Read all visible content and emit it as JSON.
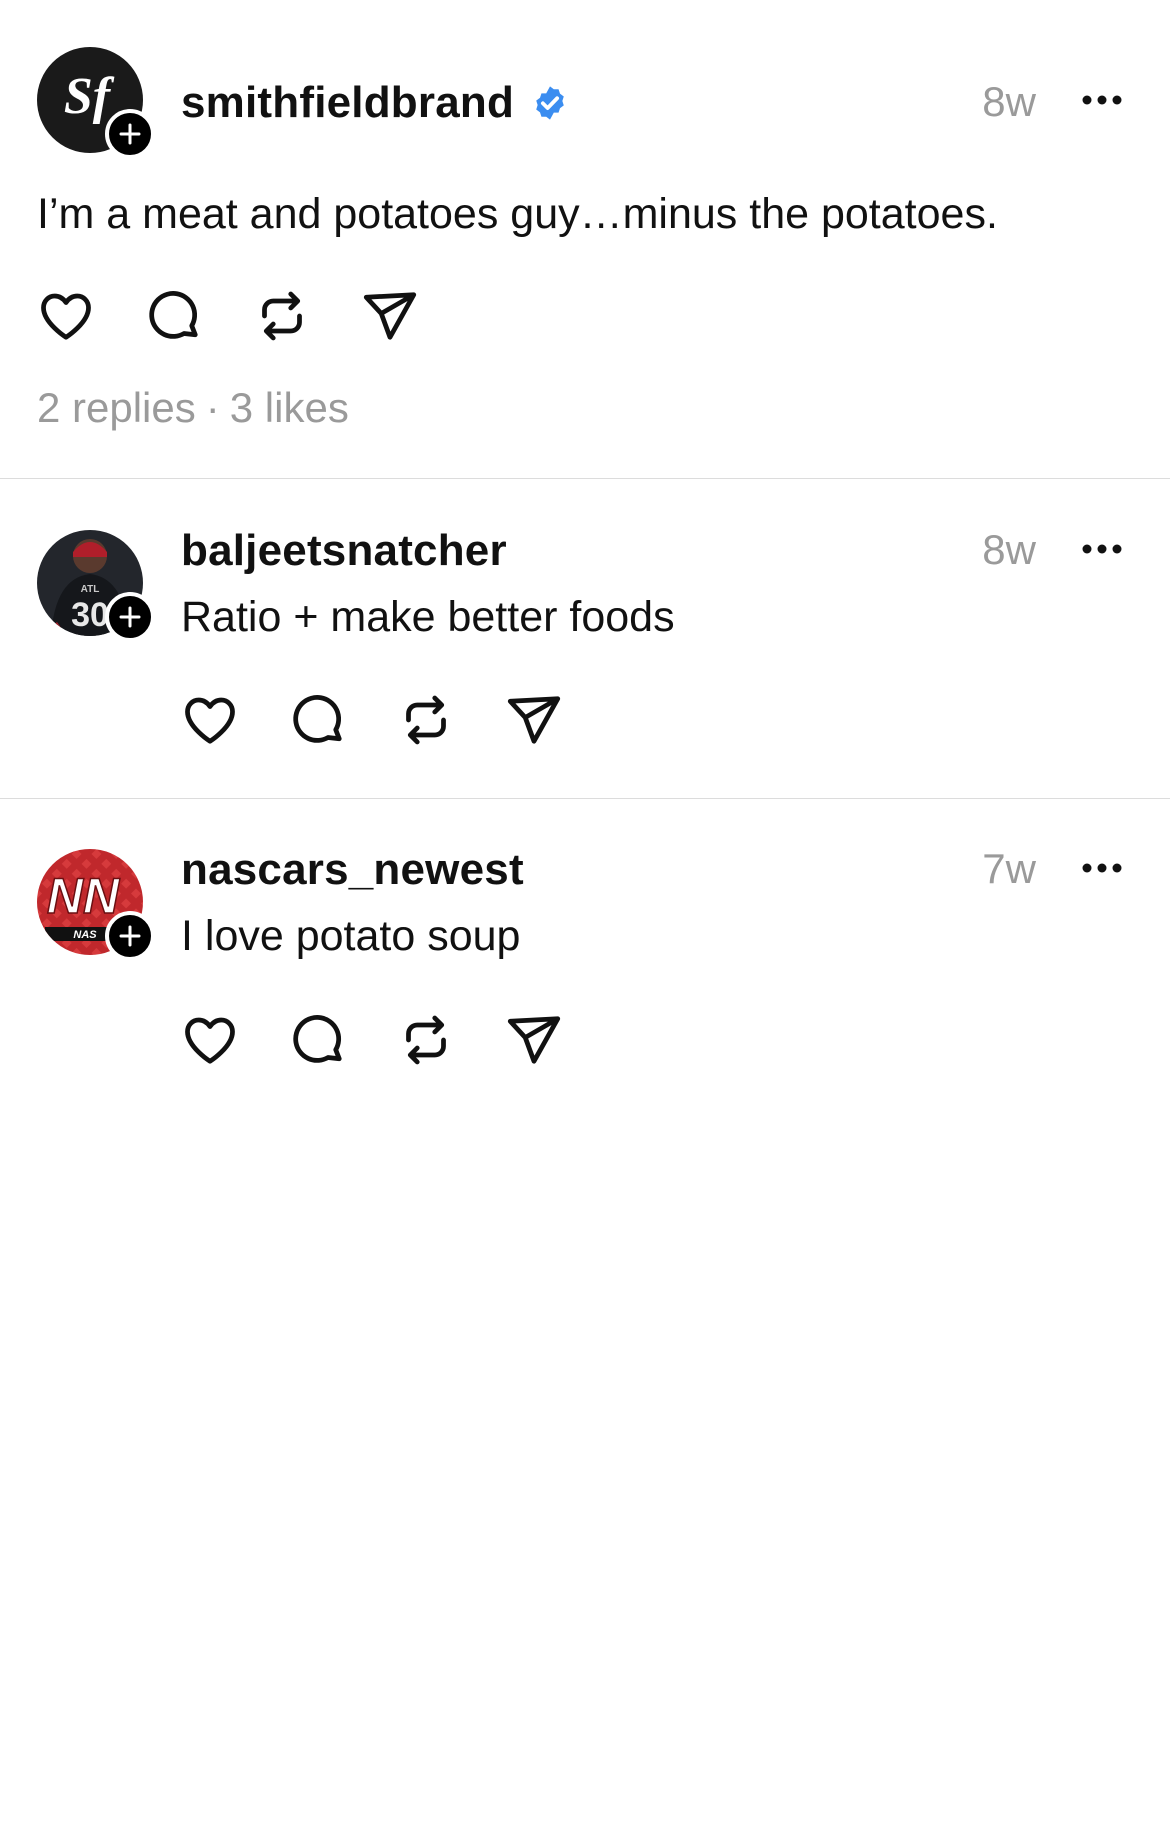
{
  "thread": {
    "posts": [
      {
        "username": "smithfieldbrand",
        "verified": true,
        "timestamp": "8w",
        "text": "I’m a meat and potatoes guy…minus the potatoes.",
        "avatar_text": "Sf",
        "stats": {
          "replies": "2 replies",
          "separator": "·",
          "likes": "3 likes"
        }
      },
      {
        "username": "baljeetsnatcher",
        "verified": false,
        "timestamp": "8w",
        "text": "Ratio + make better foods",
        "avatar_text": "ATL 30"
      },
      {
        "username": "nascars_newest",
        "verified": false,
        "timestamp": "7w",
        "text": "I love potato soup",
        "avatar_text": "NN",
        "avatar_subtext": "NAS"
      }
    ]
  },
  "icons": {
    "like": "heart-icon",
    "reply": "comment-bubble-icon",
    "repost": "repost-icon",
    "share": "send-icon",
    "more": "more-dots-icon",
    "follow": "plus-icon",
    "verified": "verified-badge-icon"
  },
  "colors": {
    "text": "#111111",
    "muted": "#9a9a9a",
    "divider": "#dcdcdc",
    "verified": "#3b8df0"
  }
}
